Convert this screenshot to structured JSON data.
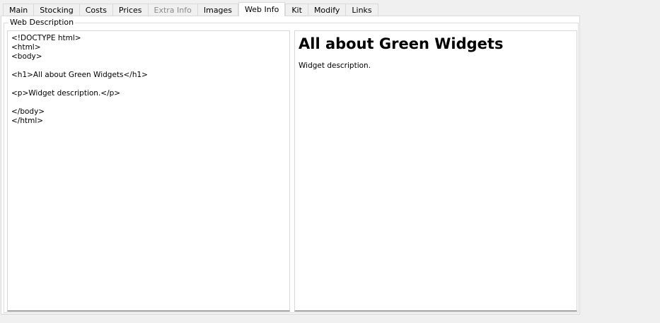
{
  "tabs": [
    {
      "label": "Main",
      "state": "normal"
    },
    {
      "label": "Stocking",
      "state": "normal"
    },
    {
      "label": "Costs",
      "state": "normal"
    },
    {
      "label": "Prices",
      "state": "normal"
    },
    {
      "label": "Extra Info",
      "state": "disabled"
    },
    {
      "label": "Images",
      "state": "normal"
    },
    {
      "label": "Web Info",
      "state": "active"
    },
    {
      "label": "Kit",
      "state": "normal"
    },
    {
      "label": "Modify",
      "state": "normal"
    },
    {
      "label": "Links",
      "state": "normal"
    }
  ],
  "group": {
    "title": "Web Description"
  },
  "editor": {
    "content": "<!DOCTYPE html>\n<html>\n<body>\n\n<h1>All about Green Widgets</h1>\n\n<p>Widget description.</p>\n\n</body>\n</html>"
  },
  "preview": {
    "heading": "All about Green Widgets",
    "paragraph": "Widget description."
  }
}
